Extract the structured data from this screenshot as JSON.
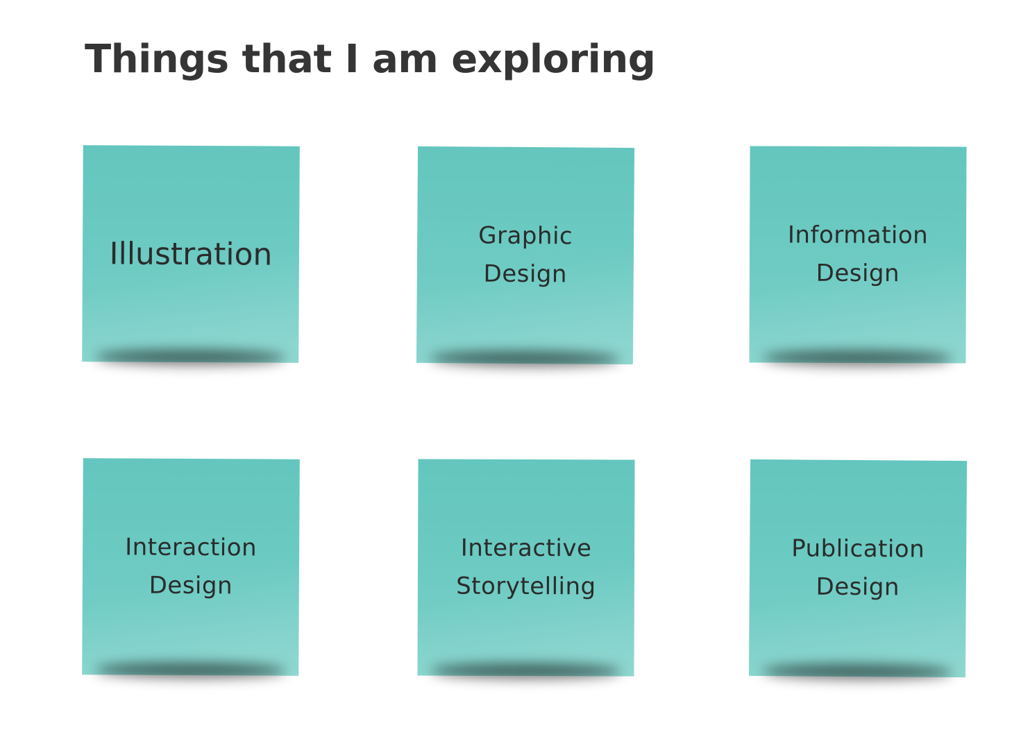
{
  "heading": "Things that I am exploring",
  "note_color": "#6bcac2",
  "notes": [
    {
      "label": "Illustration"
    },
    {
      "label": "Graphic\nDesign"
    },
    {
      "label": "Information\nDesign"
    },
    {
      "label": "Interaction\nDesign"
    },
    {
      "label": "Interactive\nStorytelling"
    },
    {
      "label": "Publication\nDesign"
    }
  ]
}
